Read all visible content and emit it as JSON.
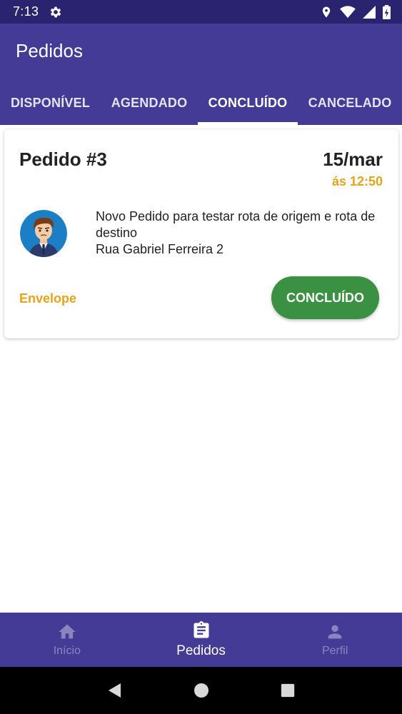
{
  "status_bar": {
    "time": "7:13",
    "icons": [
      "gear-icon",
      "location-icon",
      "wifi-icon",
      "signal-icon",
      "battery-icon"
    ]
  },
  "header": {
    "title": "Pedidos"
  },
  "tabs": [
    {
      "label": "DISPONÍVEL",
      "active": false
    },
    {
      "label": "AGENDADO",
      "active": false
    },
    {
      "label": "CONCLUÍDO",
      "active": true
    },
    {
      "label": "CANCELADO",
      "active": false
    }
  ],
  "order": {
    "title": "Pedido #3",
    "date": "15/mar",
    "time": "ás 12:50",
    "description": "Novo Pedido para testar rota de origem e rota de destino",
    "address": "Rua Gabriel Ferreira 2",
    "package_type": "Envelope",
    "status_label": "CONCLUÍDO",
    "status_color": "#3a9141",
    "accent_color": "#e7a319"
  },
  "bottom_nav": {
    "items": [
      {
        "label": "Início",
        "icon": "home-icon",
        "active": false
      },
      {
        "label": "Pedidos",
        "icon": "clipboard-icon",
        "active": true
      },
      {
        "label": "Perfil",
        "icon": "person-icon",
        "active": false
      }
    ]
  },
  "system_nav": [
    "back-icon",
    "home-circle-icon",
    "recents-icon"
  ],
  "colors": {
    "primary": "#433b96",
    "status_bar": "#2a2470"
  }
}
